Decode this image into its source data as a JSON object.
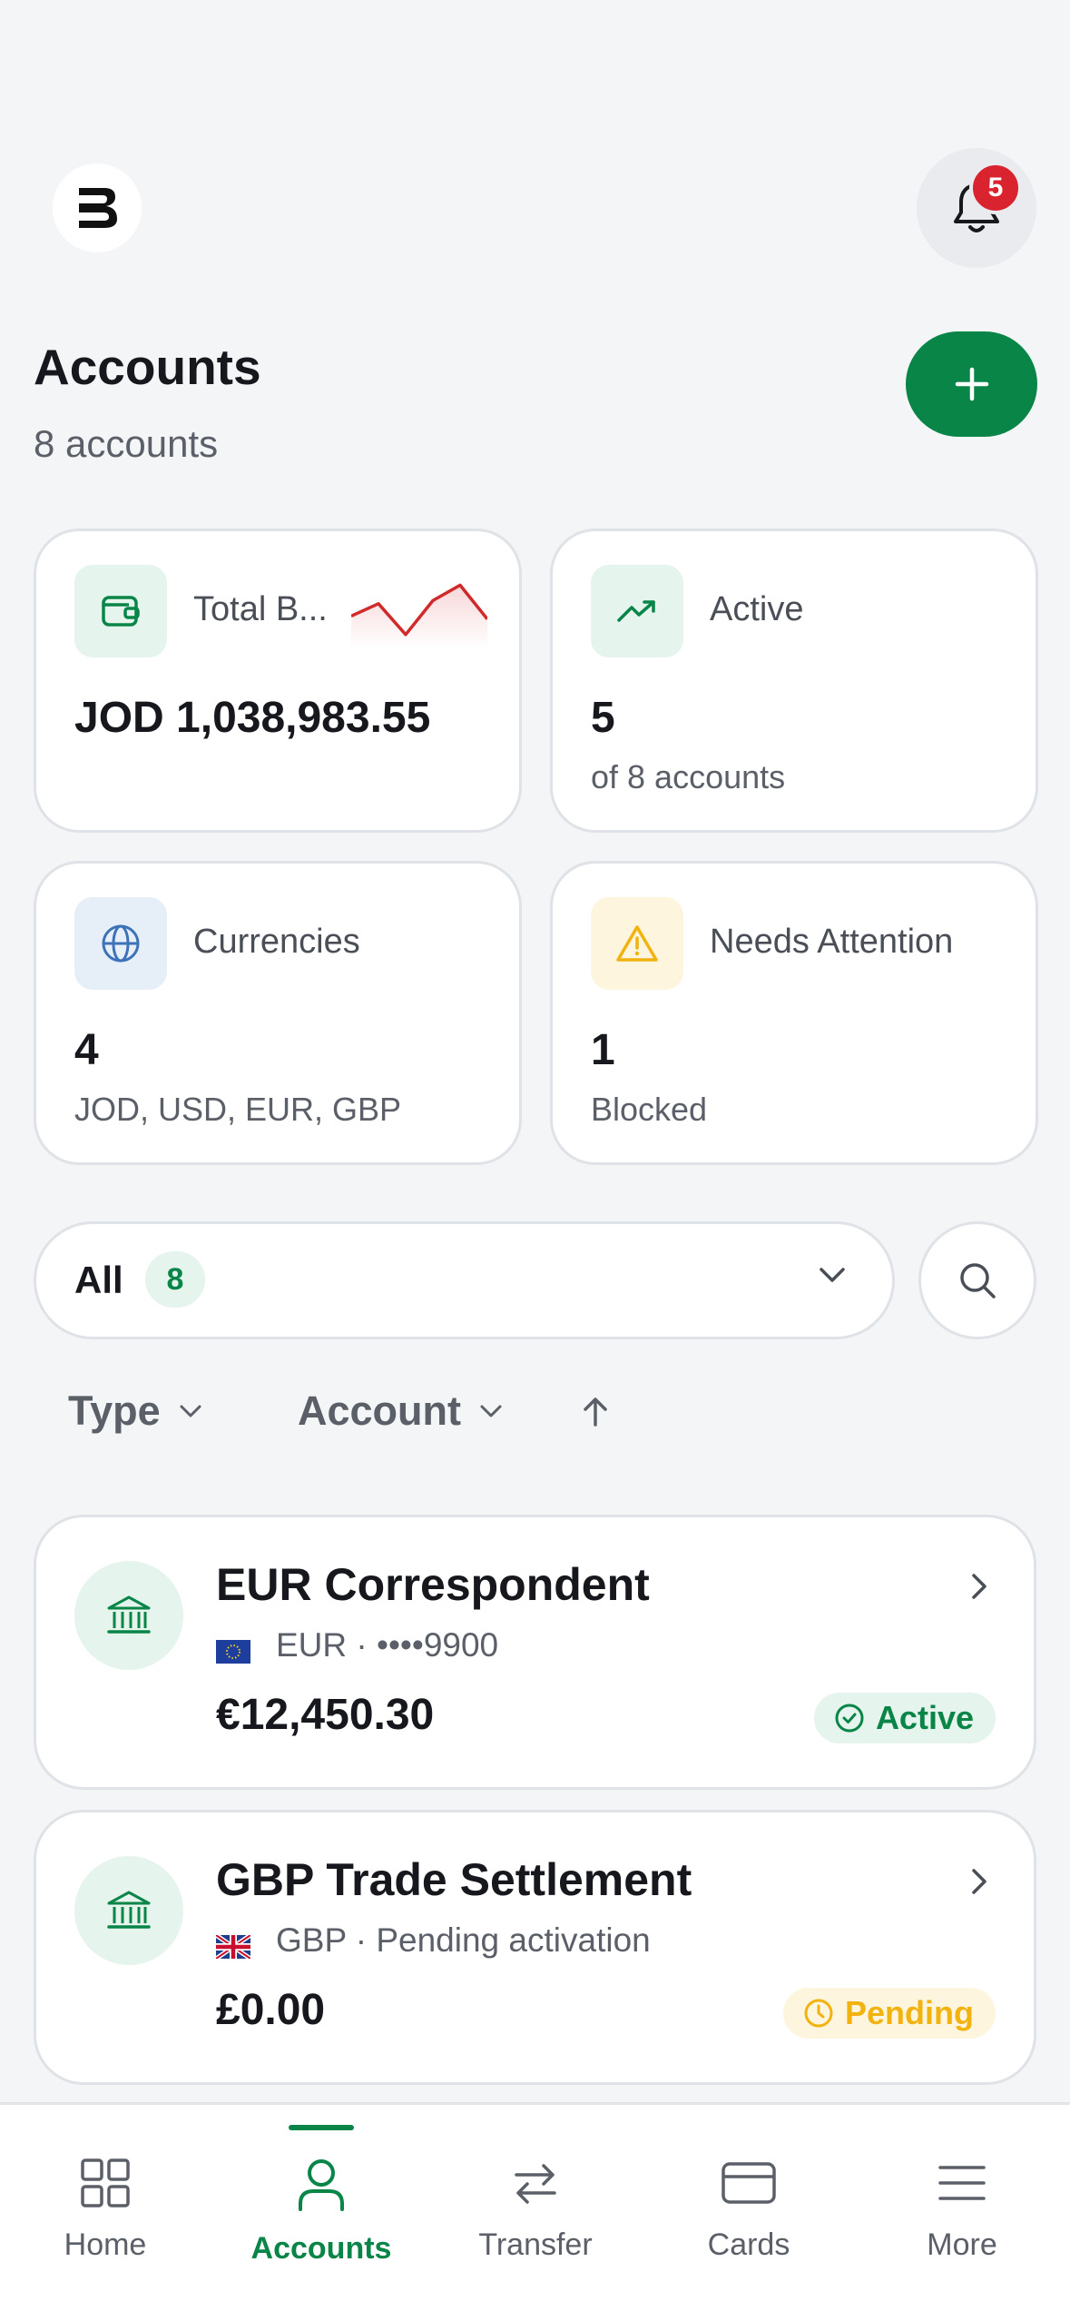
{
  "header": {
    "notifications_count": "5"
  },
  "page": {
    "title": "Accounts",
    "subtitle": "8 accounts"
  },
  "stats": {
    "total_balance": {
      "label": "Total B...",
      "value": "JOD 1,038,983.55",
      "sparkline": [
        0.55,
        0.35,
        0.85,
        0.3,
        0.05,
        0.6
      ]
    },
    "active": {
      "label": "Active",
      "value": "5",
      "sub": "of 8 accounts"
    },
    "currencies": {
      "label": "Currencies",
      "value": "4",
      "sub": "JOD, USD, EUR, GBP"
    },
    "attention": {
      "label": "Needs Attention",
      "value": "1",
      "sub": "Blocked"
    }
  },
  "filter": {
    "selected": "All",
    "count": "8"
  },
  "sort": {
    "type_label": "Type",
    "account_label": "Account"
  },
  "accounts": [
    {
      "name": "EUR Correspondent",
      "meta": "EUR · ••••9900",
      "balance": "€12,450.30",
      "status": "Active"
    },
    {
      "name": "GBP Trade Settlement",
      "meta": "GBP · Pending activation",
      "balance": "£0.00",
      "status": "Pending"
    }
  ],
  "nav": {
    "home": "Home",
    "accounts": "Accounts",
    "transfer": "Transfer",
    "cards": "Cards",
    "more": "More"
  },
  "colors": {
    "brand_green": "#0a8548",
    "alert_red": "#d9232e",
    "pending_amber": "#f2b20f"
  }
}
